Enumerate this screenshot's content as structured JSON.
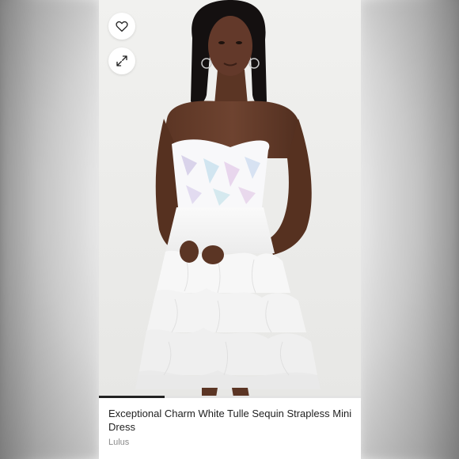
{
  "product": {
    "title": "Exceptional Charm White Tulle Sequin Strapless Mini Dress",
    "brand": "Lulus",
    "image_alt": "model wearing white strapless tulle mini dress"
  },
  "gallery": {
    "progress_fraction": 0.25
  },
  "icons": {
    "like": "heart-outline-icon",
    "expand": "expand-arrows-icon"
  },
  "colors": {
    "page_bg": "#e6e6e6",
    "text_primary": "#1f1f1f",
    "text_secondary": "#8a8a8a",
    "progress": "#222222"
  }
}
